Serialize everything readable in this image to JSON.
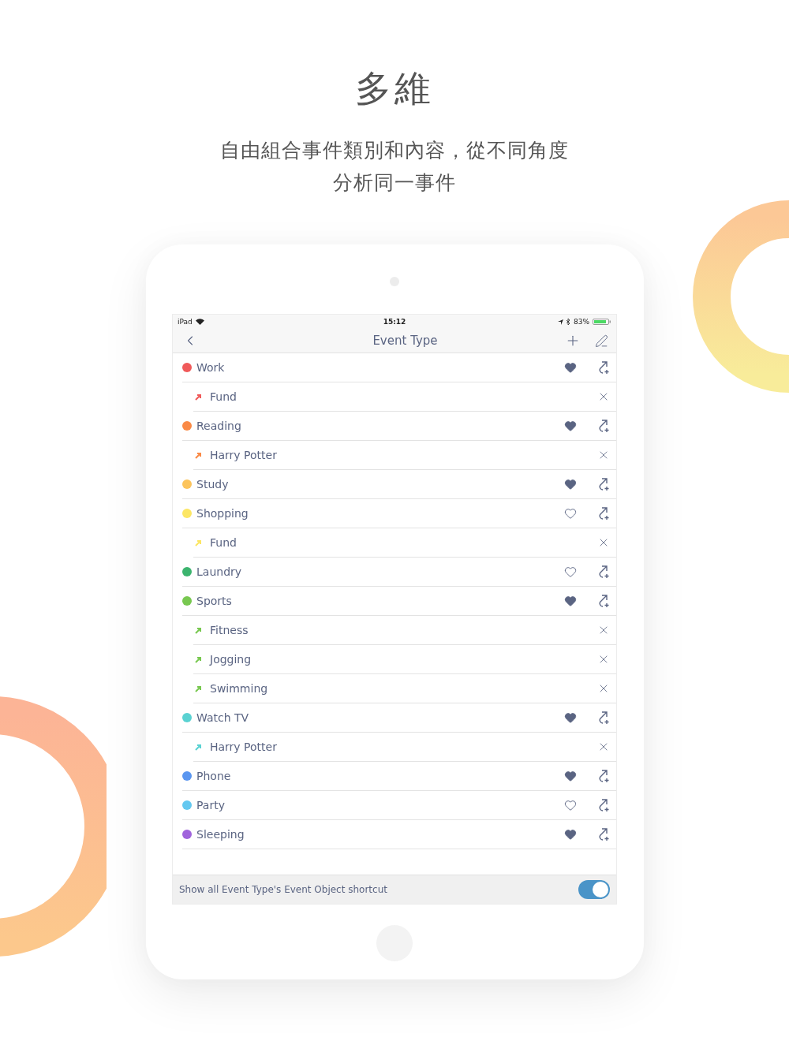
{
  "headline": "多維",
  "subtitle_lines": [
    "自由組合事件類別和內容，從不同角度",
    "分析同一事件"
  ],
  "status_bar": {
    "device": "iPad",
    "time": "15:12",
    "battery": "83%"
  },
  "nav": {
    "title": "Event Type"
  },
  "event_types": [
    {
      "name": "Work",
      "color": "#f05a5a",
      "favorite": true,
      "children": [
        {
          "name": "Fund"
        }
      ]
    },
    {
      "name": "Reading",
      "color": "#fa8a46",
      "favorite": true,
      "children": [
        {
          "name": "Harry Potter"
        }
      ]
    },
    {
      "name": "Study",
      "color": "#fcc45c",
      "favorite": true
    },
    {
      "name": "Shopping",
      "color": "#fce664",
      "favorite": false,
      "children": [
        {
          "name": "Fund"
        }
      ]
    },
    {
      "name": "Laundry",
      "color": "#3cb46e",
      "favorite": false
    },
    {
      "name": "Sports",
      "color": "#78c850",
      "favorite": true,
      "children": [
        {
          "name": "Fitness"
        },
        {
          "name": "Jogging"
        },
        {
          "name": "Swimming"
        }
      ]
    },
    {
      "name": "Watch TV",
      "color": "#5ad2d2",
      "favorite": true,
      "children": [
        {
          "name": "Harry Potter"
        }
      ]
    },
    {
      "name": "Phone",
      "color": "#5a96f0",
      "favorite": true
    },
    {
      "name": "Party",
      "color": "#64c8f0",
      "favorite": false
    },
    {
      "name": "Sleeping",
      "color": "#a064dc",
      "favorite": true
    }
  ],
  "footer": {
    "label": "Show all Event Type's Event Object shortcut",
    "on": true
  }
}
